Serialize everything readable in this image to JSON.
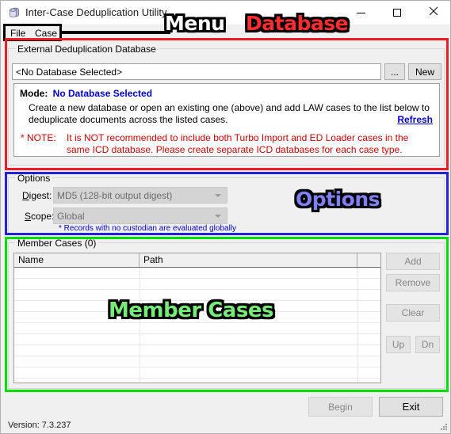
{
  "window": {
    "title": "Inter-Case Deduplication Utility",
    "icon": "database-stack-icon",
    "minimize_label": "—",
    "maximize_label": "□",
    "close_label": "✕"
  },
  "menubar": {
    "items": [
      {
        "label": "File",
        "name": "menu-file"
      },
      {
        "label": "Case",
        "name": "menu-case"
      }
    ]
  },
  "database_group": {
    "legend": "External Deduplication Database",
    "path_value": "<No Database Selected>",
    "path_placeholder": "<No Database Selected>",
    "browse_label": "...",
    "new_label": "New",
    "info": {
      "mode_label": "Mode:",
      "mode_value": "No Database Selected",
      "body": "Create a new database or open an existing one (above) and add LAW cases to the list below to deduplicate documents across the listed cases.",
      "refresh_label": "Refresh",
      "note_star": "* NOTE:",
      "note_text": "It is NOT recommended to include both Turbo Import and ED Loader cases in the same ICD database. Please create separate ICD databases for each case type."
    }
  },
  "options_group": {
    "legend": "Options",
    "digest_label": "Digest:",
    "digest_accel": "D",
    "digest_value": "MD5 (128-bit output digest)",
    "scope_label": "Scope:",
    "scope_accel": "S",
    "scope_value": "Global",
    "custodian_note": "* Records with no custodian are evaluated globally"
  },
  "member_cases_group": {
    "legend": "Member Cases (0)",
    "count": 0,
    "columns": [
      "Name",
      "Path",
      ""
    ],
    "rows": [],
    "buttons": {
      "add": "Add",
      "remove": "Remove",
      "clear": "Clear",
      "up": "Up",
      "dn": "Dn"
    }
  },
  "footer": {
    "begin_label": "Begin",
    "exit_label": "Exit",
    "version": "Version: 7.3.237"
  },
  "annotations": [
    {
      "text": "Menu",
      "color": "#ffffff",
      "name": "annotation-menu"
    },
    {
      "text": "Database",
      "color": "#ff2d2d",
      "name": "annotation-database"
    },
    {
      "text": "Options",
      "color": "#8080f5",
      "name": "annotation-options"
    },
    {
      "text": "Member Cases",
      "color": "#77ea77",
      "name": "annotation-member-cases"
    }
  ],
  "colors": {
    "annotation_menu_box": "#000000",
    "annotation_database_box": "#ee1c24",
    "annotation_options_box": "#2222dd",
    "annotation_member_box": "#00e000",
    "link": "#0000cc",
    "warning": "#cc0000",
    "window_bg": "#f0f0f0"
  }
}
